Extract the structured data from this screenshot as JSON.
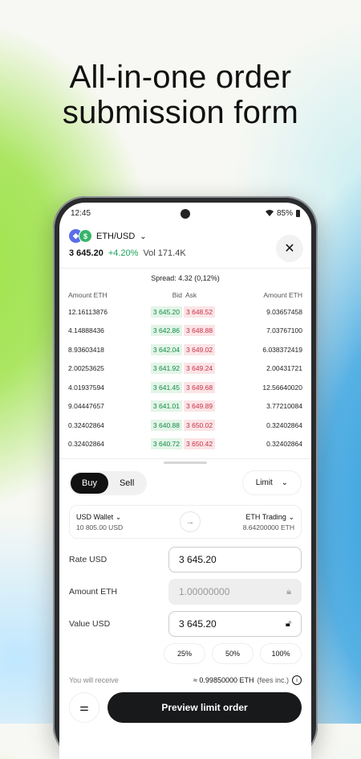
{
  "headline": {
    "line1": "All-in-one order",
    "line2": "submission form"
  },
  "status_bar": {
    "time": "12:45",
    "battery": "85%"
  },
  "pair": {
    "name": "ETH/USD",
    "price": "3 645.20",
    "change": "+4.20%",
    "volume": "Vol 171.4K"
  },
  "orderbook": {
    "spread": "Spread: 4.32 (0,12%)",
    "headers": {
      "amount_left": "Amount ETH",
      "bid": "Bid",
      "ask": "Ask",
      "amount_right": "Amount ETH"
    },
    "rows": [
      {
        "amount_left": "12.16113876",
        "bid": "3 645.20",
        "ask": "3 648.52",
        "amount_right": "9.03657458"
      },
      {
        "amount_left": "4.14888436",
        "bid": "3 642.86",
        "ask": "3 648.88",
        "amount_right": "7.03767100"
      },
      {
        "amount_left": "8.93603418",
        "bid": "3 642.04",
        "ask": "3 649.02",
        "amount_right": "6.038372419"
      },
      {
        "amount_left": "2.00253625",
        "bid": "3 641.92",
        "ask": "3 649.24",
        "amount_right": "2.00431721"
      },
      {
        "amount_left": "4.01937594",
        "bid": "3 641.45",
        "ask": "3 649.68",
        "amount_right": "12.56640020"
      },
      {
        "amount_left": "9.04447657",
        "bid": "3 641.01",
        "ask": "3 649.89",
        "amount_right": "3.77210084"
      },
      {
        "amount_left": "0.32402864",
        "bid": "3 640.88",
        "ask": "3 650.02",
        "amount_right": "0.32402864"
      },
      {
        "amount_left": "0.32402864",
        "bid": "3 640.72",
        "ask": "3 650.42",
        "amount_right": "0.32402864"
      }
    ]
  },
  "form": {
    "buy_label": "Buy",
    "sell_label": "Sell",
    "order_type": "Limit",
    "from_wallet": {
      "name": "USD Wallet",
      "balance": "10 805.00 USD"
    },
    "to_wallet": {
      "name": "ETH Trading",
      "balance": "8.64200000 ETH"
    },
    "rate_label": "Rate USD",
    "rate_value": "3 645.20",
    "amount_label": "Amount ETH",
    "amount_value": "1.00000000",
    "value_label": "Value USD",
    "value_value": "3 645.20",
    "percents": [
      "25%",
      "50%",
      "100%"
    ],
    "receive_label": "You will receive",
    "receive_value": "≈ 0.99850000 ETH",
    "receive_fees": "(fees inc.)",
    "preview_button": "Preview limit order"
  },
  "colors": {
    "bid_green": "#138a44",
    "ask_red": "#c9314a",
    "dark_button": "#17191b"
  }
}
